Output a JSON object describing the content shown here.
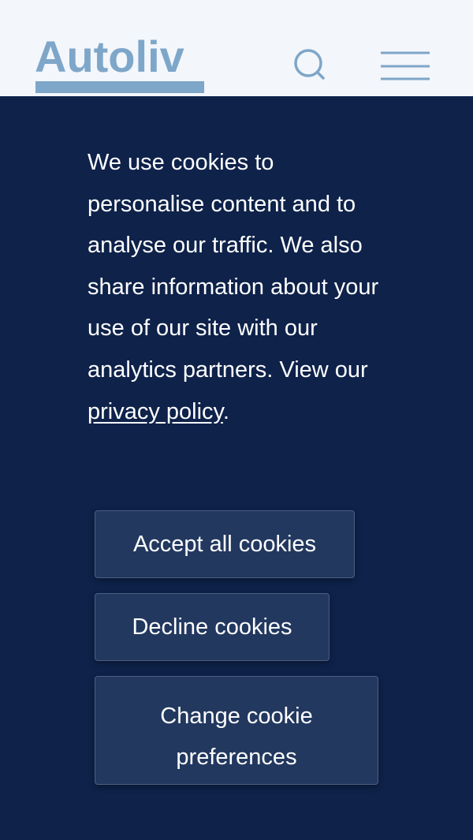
{
  "header": {
    "logo_text": "Autoliv",
    "icons": {
      "search": "search-icon",
      "menu": "hamburger-menu-icon"
    },
    "colors": {
      "background": "#f3f6fb",
      "logo": "#7ea6c9",
      "icon": "#7ea6c9"
    }
  },
  "cookie_banner": {
    "message_before_link": "We use cookies to personalise content and to analyse our traffic. We also share information about your use of our site with our analytics partners. View our ",
    "privacy_link_label": "privacy policy",
    "message_after_link": ".",
    "buttons": {
      "accept_label": "Accept all cookies",
      "decline_label": "Decline cookies",
      "change_label": "Change cookie preferences"
    },
    "colors": {
      "background": "#0e224a",
      "button_background": "#22385f",
      "button_border": "#4a5f82",
      "text": "#ffffff"
    }
  }
}
